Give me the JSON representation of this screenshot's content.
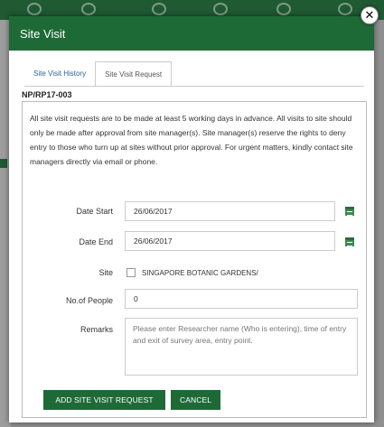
{
  "modal": {
    "title": "Site Visit",
    "close_glyph": "✕"
  },
  "tabs": [
    {
      "label": "Site Visit History",
      "active": false
    },
    {
      "label": "Site Visit Request",
      "active": true
    }
  ],
  "request": {
    "reference": "NP/RP17-003",
    "notice": "All site visit requests are to be made at least 5 working days in advance. All visits to site should only be made after approval from site manager(s). Site manager(s) reserve the rights to deny entry to those who turn up at sites without prior approval. For urgent matters, kindly contact site managers directly via email or phone.",
    "date_start": {
      "label": "Date Start",
      "value": "26/06/2017",
      "icon": "calendar-icon"
    },
    "date_end": {
      "label": "Date End",
      "value": "26/06/2017",
      "icon": "calendar-icon"
    },
    "site": {
      "label": "Site",
      "option": "SINGAPORE BOTANIC GARDENS/",
      "checked": false
    },
    "people": {
      "label": "No.of People",
      "value": "0"
    },
    "remarks": {
      "label": "Remarks",
      "placeholder": "Please enter Researcher name (Who is entering), time of entry and exit of survey area, entry point."
    }
  },
  "buttons": {
    "add": "ADD SITE VISIT REQUEST",
    "cancel": "CANCEL"
  },
  "colors": {
    "brand_green": "#1e6a37",
    "calendar_green": "#3d8a4f",
    "link_blue": "#2a6496"
  }
}
